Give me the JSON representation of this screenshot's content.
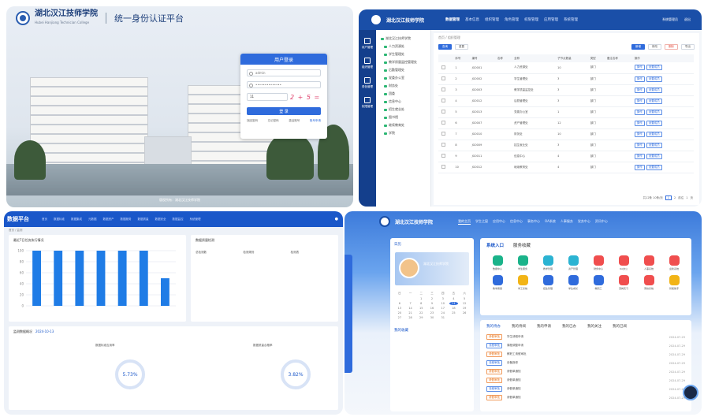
{
  "login_page": {
    "school_name": "湖北汉江技师学院",
    "school_name_en": "Hubei Hanjiang Technician College",
    "platform_title": "统一身份认证平台",
    "login_title": "用户登录",
    "username_value": "admin",
    "password_value": "••••••••••••••",
    "captcha_value": "11",
    "captcha_text": "2 + 5 =",
    "login_button": "登 录",
    "links": [
      "找回密码",
      "忘记密码",
      "激活账号",
      "账号申请"
    ],
    "footer": "版权所有：湖北汉江技师学院"
  },
  "admin_page": {
    "school_name": "湖北汉江技师学院",
    "menu": [
      "数据管理",
      "基本信息",
      "组织管理",
      "角色管理",
      "权限管理",
      "应用管理",
      "系统管理"
    ],
    "right_items": [
      "系统管理员",
      "退出"
    ],
    "side_items": [
      "用户管理",
      "组织管理",
      "角色管理",
      "权限管理"
    ],
    "tree_items": [
      "湖北汉江技师学院",
      "人力资源处",
      "学生管理处",
      "教学质量监控管理处",
      "后勤管理处",
      "党委办公室",
      "财务处",
      "团委",
      "信息中心",
      "招生就业处",
      "图书馆",
      "继续教育处",
      "学院"
    ],
    "breadcrumb": "首页 / 组织管理",
    "tool_buttons": [
      "查询",
      "重置",
      "新增",
      "修改",
      "删除",
      "导出"
    ],
    "table_headers": [
      "",
      "序号",
      "编号",
      "名称",
      "全称",
      "子节点数量",
      "类型",
      "备注名称",
      "操作"
    ],
    "table_rows": [
      [
        "1",
        "JG0001",
        "",
        "人力资源处",
        "10",
        "部门",
        "",
        "操作",
        "设置成员"
      ],
      [
        "2",
        "JG0002",
        "",
        "学生管理处",
        "3",
        "部门",
        "",
        "操作",
        "设置成员"
      ],
      [
        "3",
        "JG0003",
        "",
        "教学质量监控处",
        "3",
        "部门",
        "",
        "操作",
        "设置成员"
      ],
      [
        "4",
        "JG0012",
        "",
        "后勤管理处",
        "3",
        "部门",
        "",
        "操作",
        "设置成员"
      ],
      [
        "5",
        "JG0013",
        "",
        "党委办公室",
        "1",
        "部门",
        "",
        "操作",
        "设置成员"
      ],
      [
        "6",
        "JG0007",
        "",
        "资产管理处",
        "12",
        "部门",
        "",
        "操作",
        "设置成员"
      ],
      [
        "7",
        "JG0010",
        "",
        "财务处",
        "10",
        "部门",
        "",
        "操作",
        "设置成员"
      ],
      [
        "8",
        "JG0009",
        "",
        "招生就业处",
        "3",
        "部门",
        "",
        "操作",
        "设置成员"
      ],
      [
        "9",
        "JG0011",
        "",
        "信息中心",
        "4",
        "部门",
        "",
        "操作",
        "设置成员"
      ],
      [
        "10",
        "JG0012",
        "",
        "继续教育处",
        "4",
        "部门",
        "",
        "操作",
        "设置成员"
      ]
    ],
    "pagination": [
      "共12条 10条/页",
      "1",
      "2",
      "前往",
      "1",
      "页"
    ]
  },
  "data_page": {
    "title": "数据平台",
    "menu": [
      "首页",
      "数据标准",
      "数据集成",
      "元数据",
      "数据资产",
      "数据服务",
      "数据质量",
      "数据安全",
      "数据监控",
      "系统管理"
    ],
    "breadcrumb": "首页 / 监测",
    "chart_card_title": "最近7日任务执行情况",
    "info_card_title": "数据质量检测",
    "info_labels": [
      "总检测数",
      "检测规则",
      "检测表"
    ],
    "gauge1": "5.73%",
    "gauge2": "3.82%",
    "stats_title": "监测数据概况",
    "stats_date": "2024-10-13",
    "sub1": "数据标准应用率",
    "sub2": "数据质量合格率"
  },
  "chart_data": {
    "type": "bar",
    "categories": [
      "",
      "",
      "",
      "",
      "",
      "",
      ""
    ],
    "values": [
      100,
      100,
      100,
      100,
      100,
      100,
      50
    ],
    "ylim": [
      0,
      100
    ],
    "ticks": [
      "100",
      "80",
      "60",
      "40",
      "20",
      "0"
    ],
    "color": "#1f7ce6"
  },
  "portal_page": {
    "school_name": "湖北汉江技师学院",
    "menu": [
      "我的主页",
      "学生之窗",
      "应用中心",
      "信息中心",
      "事务中心",
      "OA系统",
      "人事服务",
      "党务中心",
      "资讯中心"
    ],
    "calendar_title": "日历",
    "user_name": "湖北汉江技师学院",
    "weekdays": [
      "日",
      "一",
      "二",
      "三",
      "四",
      "五",
      "六"
    ],
    "days": [
      "",
      "",
      "1",
      "2",
      "3",
      "4",
      "5",
      "6",
      "7",
      "8",
      "9",
      "10",
      "11",
      "12",
      "13",
      "14",
      "15",
      "16",
      "17",
      "18",
      "19",
      "20",
      "21",
      "22",
      "23",
      "24",
      "25",
      "26",
      "27",
      "28",
      "29",
      "30",
      "31"
    ],
    "today": "11",
    "my_collect": "我的收藏",
    "apps_tabs": [
      "系统入口",
      "服务收藏"
    ],
    "apps": [
      {
        "label": "数据中心",
        "color": "#1bb38a"
      },
      {
        "label": "学生服务",
        "color": "#1bb38a"
      },
      {
        "label": "教学管理",
        "color": "#2bb3d2"
      },
      {
        "label": "资产管理",
        "color": "#2bb3d2"
      },
      {
        "label": "财务中心",
        "color": "#f04e4e"
      },
      {
        "label": "OA办公",
        "color": "#f04e4e"
      },
      {
        "label": "人事系统",
        "color": "#f04e4e"
      },
      {
        "label": "迎新系统",
        "color": "#f04e4e"
      },
      {
        "label": "教学质量",
        "color": "#2f6bdc"
      },
      {
        "label": "学工系统",
        "color": "#f2b416"
      },
      {
        "label": "招生管理",
        "color": "#2f6bdc"
      },
      {
        "label": "学生成长",
        "color": "#2f6bdc"
      },
      {
        "label": "教职工",
        "color": "#2f6bdc"
      },
      {
        "label": "顶岗实习",
        "color": "#f04e4e"
      },
      {
        "label": "离校系统",
        "color": "#f04e4e"
      },
      {
        "label": "智能助手",
        "color": "#f2b416"
      }
    ],
    "task_tabs": [
      "我的待办",
      "我的待阅",
      "我的申请",
      "我的已办",
      "我的关注",
      "我的已阅"
    ],
    "tasks": [
      {
        "tag": "请假审批",
        "title": "学生请假申请",
        "date": "2024-07-29"
      },
      {
        "tag": "流程审批",
        "title": "课程调整申请",
        "date": "2024-07-29"
      },
      {
        "tag": "请假审批",
        "title": "教职工请假审批",
        "date": "2024-07-29"
      },
      {
        "tag": "流程审批",
        "title": "设备报修",
        "date": "2024-07-29"
      },
      {
        "tag": "请假审批",
        "title": "请假单通知",
        "date": "2024-07-29"
      },
      {
        "tag": "请假审批",
        "title": "请假单通知",
        "date": "2024-07-29"
      },
      {
        "tag": "流程审批",
        "title": "请假单通知",
        "date": "2024-07-29"
      },
      {
        "tag": "请假审批",
        "title": "请假单通知",
        "date": "2024-07-29"
      }
    ]
  }
}
